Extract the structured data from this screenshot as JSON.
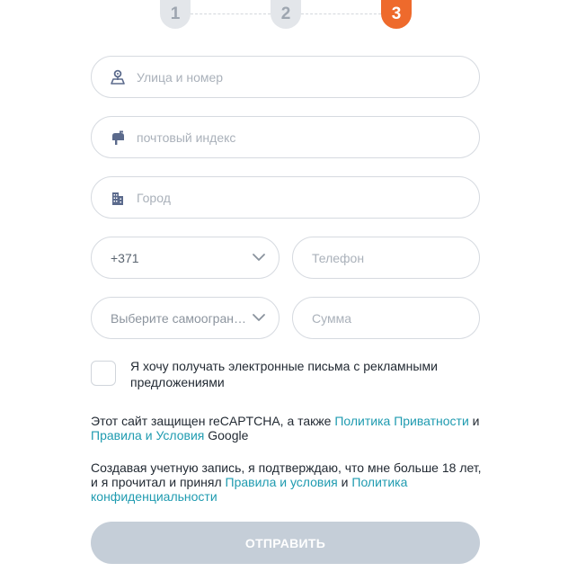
{
  "stepper": {
    "steps": [
      "1",
      "2",
      "3"
    ],
    "active_step": 3
  },
  "address": {
    "street_placeholder": "Улица и номер",
    "postal_placeholder": "почтовый индекс",
    "city_placeholder": "Город"
  },
  "phone": {
    "country_code": "+371",
    "placeholder": "Телефон"
  },
  "limits": {
    "self_exclusion_placeholder": "Выберите самоограничение",
    "amount_placeholder": "Сумма"
  },
  "marketing": {
    "label": "Я хочу получать электронные письма с рекламными предложениями",
    "checked": false
  },
  "recaptcha": {
    "text_before": "Этот сайт защищен reCAPTCHA, а также ",
    "privacy_link": "Политика Приватности",
    "and": " и ",
    "terms_link": "Правила и Условия",
    "text_after": " Google"
  },
  "consent": {
    "text_before": "Создавая учетную запись, я подтверждаю, что мне больше 18 лет, и я прочитал и принял ",
    "terms_link": "Правила и условия",
    "and": " и ",
    "privacy_link": "Политика конфиденциальности"
  },
  "submit_label": "ОТПРАВИТЬ",
  "colors": {
    "accent": "#ee6a2c",
    "link": "#1f9bb0",
    "button_disabled": "#c5ced8",
    "icon": "#5b6a8c"
  }
}
